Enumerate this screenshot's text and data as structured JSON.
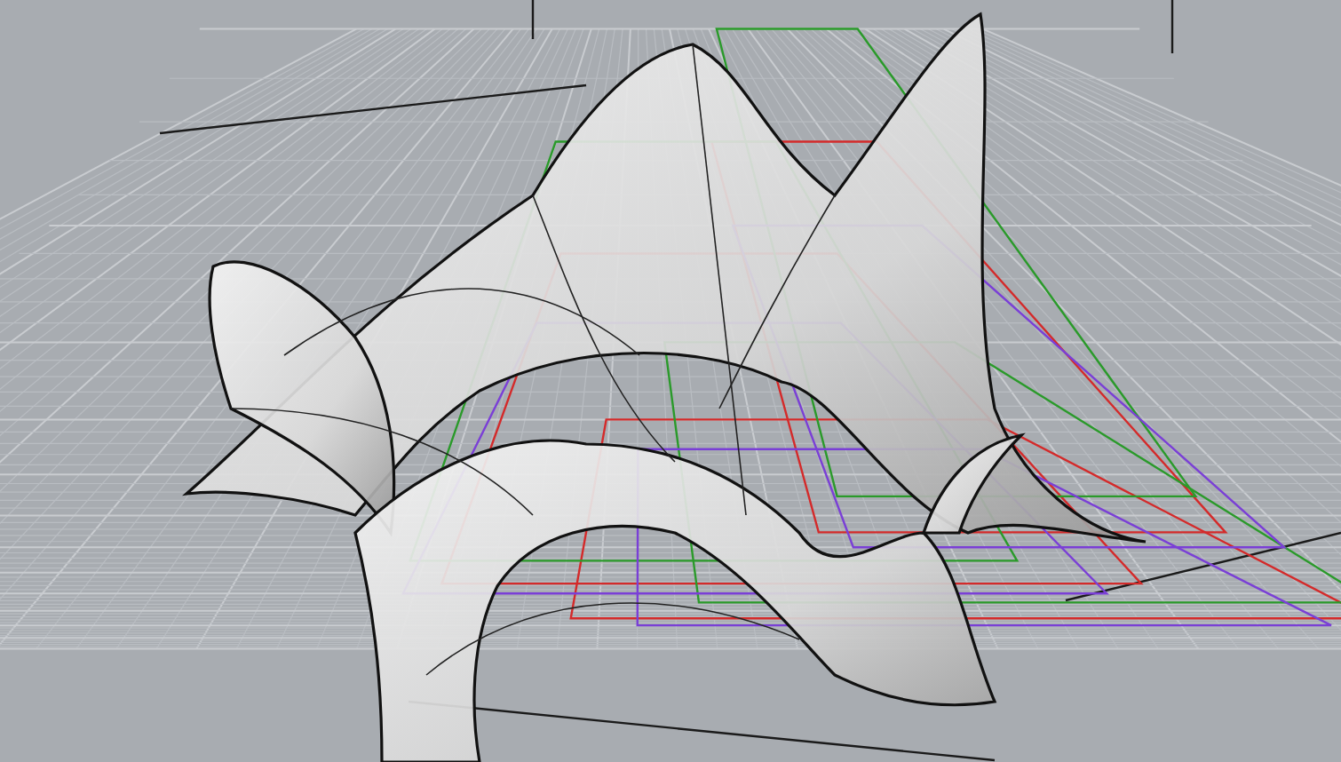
{
  "viewport": {
    "kind": "perspective"
  },
  "curves": [
    {
      "color": "#d42a2a"
    },
    {
      "color": "#2a9a2a"
    },
    {
      "color": "#7a3fd6"
    }
  ]
}
